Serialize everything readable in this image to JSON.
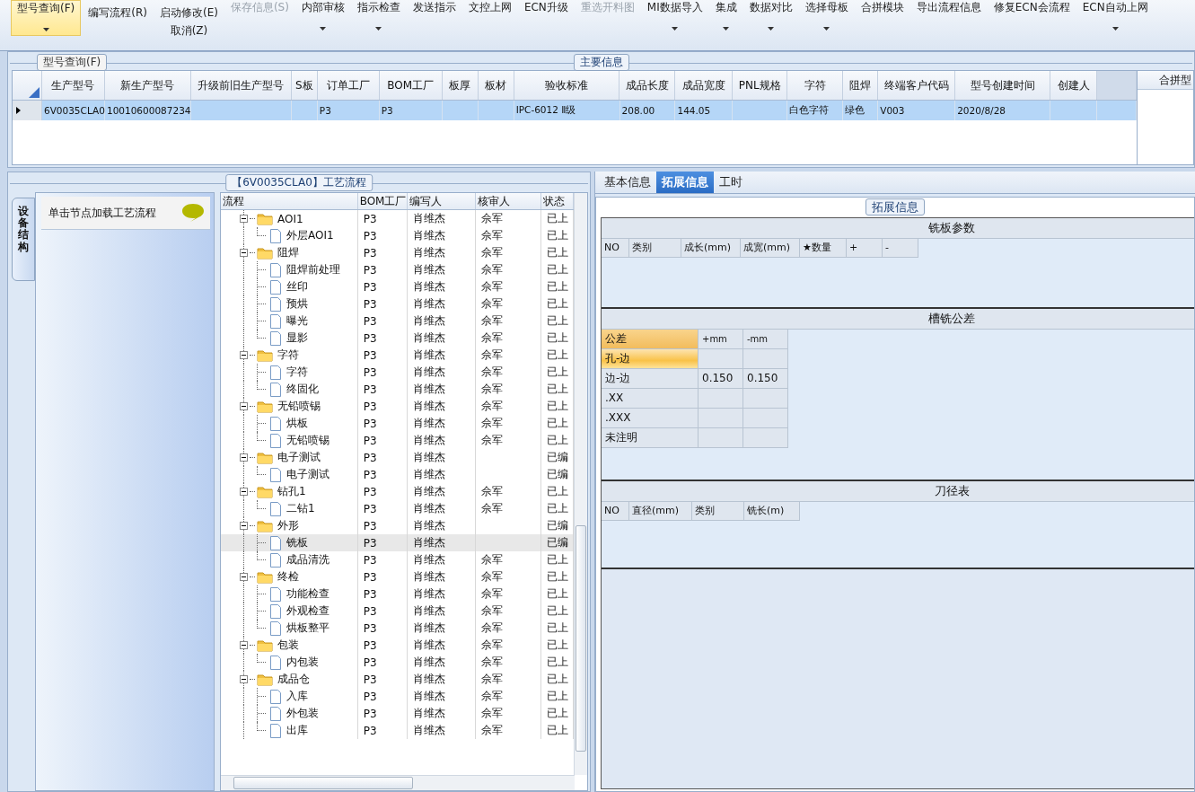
{
  "toolbar": {
    "items": [
      {
        "label": "型号查询(F)",
        "kind": "large",
        "selected": true,
        "disabled": false,
        "dropdown": true
      },
      {
        "label": "编写流程(R)",
        "kind": "small",
        "selected": false,
        "disabled": false
      },
      {
        "label": "启动修改(E)",
        "sub_label": "取消(Z)",
        "kind": "small",
        "selected": false,
        "disabled": false
      },
      {
        "label": "保存信息(S)",
        "kind": "large",
        "selected": false,
        "disabled": true,
        "dropdown": false
      },
      {
        "label": "内部审核",
        "kind": "large",
        "selected": false,
        "disabled": false,
        "dropdown": true
      },
      {
        "label": "指示检查",
        "kind": "large",
        "selected": false,
        "disabled": false,
        "dropdown": true
      },
      {
        "label": "发送指示",
        "kind": "large",
        "selected": false,
        "disabled": false,
        "dropdown": false
      },
      {
        "label": "文控上网",
        "kind": "large",
        "selected": false,
        "disabled": false,
        "dropdown": false
      },
      {
        "label": "ECN升级",
        "kind": "large",
        "selected": false,
        "disabled": false,
        "dropdown": false
      },
      {
        "label": "重选开料图",
        "kind": "large",
        "selected": false,
        "disabled": true,
        "dropdown": false
      },
      {
        "label": "MI数据导入",
        "kind": "large",
        "selected": false,
        "disabled": false,
        "dropdown": true
      },
      {
        "label": "集成",
        "kind": "large",
        "selected": false,
        "disabled": false,
        "dropdown": true
      },
      {
        "label": "数据对比",
        "kind": "large",
        "selected": false,
        "disabled": false,
        "dropdown": true
      },
      {
        "label": "选择母板",
        "kind": "large",
        "selected": false,
        "disabled": false,
        "dropdown": true
      },
      {
        "label": "合拼模块",
        "kind": "large",
        "selected": false,
        "disabled": false,
        "dropdown": false
      },
      {
        "label": "导出流程信息",
        "kind": "large",
        "selected": false,
        "disabled": false,
        "dropdown": false
      },
      {
        "label": "修复ECN会流程",
        "kind": "large",
        "selected": false,
        "disabled": false,
        "dropdown": false
      },
      {
        "label": "ECN自动上网",
        "kind": "large",
        "selected": false,
        "disabled": false,
        "dropdown": true
      }
    ]
  },
  "main_info": {
    "title": "主要信息",
    "tab": "型号查询(F)",
    "columns": [
      "生产型号",
      "新生产型号",
      "升级前旧生产型号",
      "S板",
      "订单工厂",
      "BOM工厂",
      "板厚",
      "板材",
      "验收标准",
      "成品长度",
      "成品宽度",
      "PNL规格",
      "字符",
      "阻焊",
      "终端客户代码",
      "型号创建时间",
      "创建人"
    ],
    "rows": [
      {
        "selected": true,
        "cells": [
          "6V0035CLA0",
          "10010600087234",
          null,
          null,
          "P3",
          "P3",
          null,
          null,
          "IPC-6012 Ⅱ级",
          "208.00",
          "144.05",
          null,
          "白色字符",
          "绿色",
          "V003",
          "2020/8/28",
          null
        ]
      }
    ]
  },
  "side_panel": {
    "title": "合拼型"
  },
  "process": {
    "title": "【6V0035CLA0】工艺流程",
    "side_tab": "设备结构",
    "hint": "单击节点加载工艺流程",
    "columns": [
      "流程",
      "BOM工厂",
      "编写人",
      "核审人",
      "状态"
    ],
    "nodes": [
      {
        "name": "AOI1",
        "factory": "P3",
        "writer": "肖维杰",
        "reviewer": "佘军",
        "status": "已上",
        "expanded": true,
        "selected": false,
        "children": [
          {
            "name": "外层AOI1",
            "factory": "P3",
            "writer": "肖维杰",
            "reviewer": "佘军",
            "status": "已上",
            "selected": false
          }
        ]
      },
      {
        "name": "阻焊",
        "factory": "P3",
        "writer": "肖维杰",
        "reviewer": "佘军",
        "status": "已上",
        "expanded": true,
        "selected": false,
        "children": [
          {
            "name": "阻焊前处理",
            "factory": "P3",
            "writer": "肖维杰",
            "reviewer": "佘军",
            "status": "已上",
            "selected": false
          },
          {
            "name": "丝印",
            "factory": "P3",
            "writer": "肖维杰",
            "reviewer": "佘军",
            "status": "已上",
            "selected": false
          },
          {
            "name": "预烘",
            "factory": "P3",
            "writer": "肖维杰",
            "reviewer": "佘军",
            "status": "已上",
            "selected": false
          },
          {
            "name": "曝光",
            "factory": "P3",
            "writer": "肖维杰",
            "reviewer": "佘军",
            "status": "已上",
            "selected": false
          },
          {
            "name": "显影",
            "factory": "P3",
            "writer": "肖维杰",
            "reviewer": "佘军",
            "status": "已上",
            "selected": false
          }
        ]
      },
      {
        "name": "字符",
        "factory": "P3",
        "writer": "肖维杰",
        "reviewer": "佘军",
        "status": "已上",
        "expanded": true,
        "selected": false,
        "children": [
          {
            "name": "字符",
            "factory": "P3",
            "writer": "肖维杰",
            "reviewer": "佘军",
            "status": "已上",
            "selected": false
          },
          {
            "name": "终固化",
            "factory": "P3",
            "writer": "肖维杰",
            "reviewer": "佘军",
            "status": "已上",
            "selected": false
          }
        ]
      },
      {
        "name": "无铅喷锡",
        "factory": "P3",
        "writer": "肖维杰",
        "reviewer": "佘军",
        "status": "已上",
        "expanded": true,
        "selected": false,
        "children": [
          {
            "name": "烘板",
            "factory": "P3",
            "writer": "肖维杰",
            "reviewer": "佘军",
            "status": "已上",
            "selected": false
          },
          {
            "name": "无铅喷锡",
            "factory": "P3",
            "writer": "肖维杰",
            "reviewer": "佘军",
            "status": "已上",
            "selected": false
          }
        ]
      },
      {
        "name": "电子测试",
        "factory": "P3",
        "writer": "肖维杰",
        "status": "已编",
        "expanded": true,
        "selected": false,
        "children": [
          {
            "name": "电子测试",
            "factory": "P3",
            "writer": "肖维杰",
            "status": "已编",
            "selected": false
          }
        ]
      },
      {
        "name": "钻孔1",
        "factory": "P3",
        "writer": "肖维杰",
        "reviewer": "佘军",
        "status": "已上",
        "expanded": true,
        "selected": false,
        "children": [
          {
            "name": "二钻1",
            "factory": "P3",
            "writer": "肖维杰",
            "reviewer": "佘军",
            "status": "已上",
            "selected": false
          }
        ]
      },
      {
        "name": "外形",
        "factory": "P3",
        "writer": "肖维杰",
        "status": "已编",
        "expanded": true,
        "selected": false,
        "children": [
          {
            "name": "铣板",
            "factory": "P3",
            "writer": "肖维杰",
            "status": "已编",
            "selected": true
          },
          {
            "name": "成品清洗",
            "factory": "P3",
            "writer": "肖维杰",
            "reviewer": "佘军",
            "status": "已上",
            "selected": false
          }
        ]
      },
      {
        "name": "终检",
        "factory": "P3",
        "writer": "肖维杰",
        "reviewer": "佘军",
        "status": "已上",
        "expanded": true,
        "selected": false,
        "children": [
          {
            "name": "功能检查",
            "factory": "P3",
            "writer": "肖维杰",
            "reviewer": "佘军",
            "status": "已上",
            "selected": false
          },
          {
            "name": "外观检查",
            "factory": "P3",
            "writer": "肖维杰",
            "reviewer": "佘军",
            "status": "已上",
            "selected": false
          },
          {
            "name": "烘板整平",
            "factory": "P3",
            "writer": "肖维杰",
            "reviewer": "佘军",
            "status": "已上",
            "selected": false
          }
        ]
      },
      {
        "name": "包装",
        "factory": "P3",
        "writer": "肖维杰",
        "reviewer": "佘军",
        "status": "已上",
        "expanded": true,
        "selected": false,
        "children": [
          {
            "name": "内包装",
            "factory": "P3",
            "writer": "肖维杰",
            "reviewer": "佘军",
            "status": "已上",
            "selected": false
          }
        ]
      },
      {
        "name": "成品仓",
        "factory": "P3",
        "writer": "肖维杰",
        "reviewer": "佘军",
        "status": "已上",
        "expanded": true,
        "selected": false,
        "children": [
          {
            "name": "入库",
            "factory": "P3",
            "writer": "肖维杰",
            "reviewer": "佘军",
            "status": "已上",
            "selected": false
          },
          {
            "name": "外包装",
            "factory": "P3",
            "writer": "肖维杰",
            "reviewer": "佘军",
            "status": "已上",
            "selected": false
          },
          {
            "name": "出库",
            "factory": "P3",
            "writer": "肖维杰",
            "reviewer": "佘军",
            "status": "已上",
            "selected": false
          }
        ]
      }
    ]
  },
  "detail": {
    "tabs": [
      {
        "label": "基本信息",
        "selected": false
      },
      {
        "label": "拓展信息",
        "selected": true
      },
      {
        "label": "工时",
        "selected": false
      }
    ],
    "group_title": "拓展信息",
    "sections": [
      {
        "kind": "grid",
        "title": "铣板参数",
        "columns": [
          "NO",
          "类别",
          "成长(mm)",
          "成宽(mm)",
          "★数量",
          "+",
          "-"
        ]
      },
      {
        "kind": "tolerance",
        "title": "槽铣公差",
        "columns": [
          "公差",
          "+mm",
          "-mm"
        ],
        "rows": [
          {
            "label": "孔-边",
            "selected": true
          },
          {
            "label": "边-边",
            "plus": "0.150",
            "minus": "0.150",
            "selected": false
          },
          {
            "label": ".XX",
            "selected": false
          },
          {
            "label": ".XXX",
            "selected": false
          },
          {
            "label": "未注明",
            "selected": false
          }
        ]
      },
      {
        "kind": "grid",
        "title": "刀径表",
        "columns": [
          "NO",
          "直径(mm)",
          "类别",
          "铣长(m)"
        ]
      }
    ]
  }
}
